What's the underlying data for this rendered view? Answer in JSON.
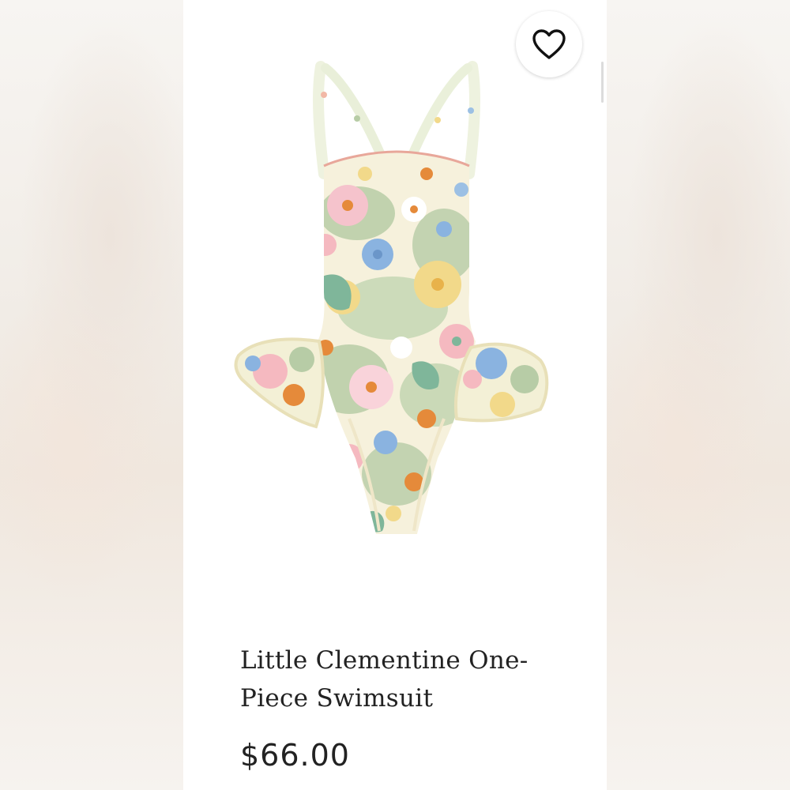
{
  "product": {
    "title": "Little Clementine One-Piece Swimsuit",
    "price": "$66.00",
    "image_alt": "",
    "favorite_icon": "heart-outline-icon"
  },
  "colors": {
    "card_background": "#ffffff",
    "text": "#222222",
    "print_base": "#f6f1dc",
    "print_sage": "#b7cca6",
    "print_pink": "#f5b9c0",
    "print_blue": "#8ab3e0",
    "print_yellow": "#f2d98a",
    "print_orange": "#e58a3a",
    "print_green": "#7fb69a"
  }
}
